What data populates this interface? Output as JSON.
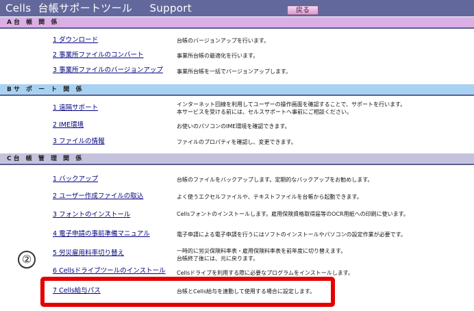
{
  "header": {
    "title": "Cells  台帳サポートツール     Support",
    "back_label": "戻る"
  },
  "sections": {
    "a": {
      "title": "A台 帳 関 係",
      "items": [
        {
          "label": "1  ダウンロード",
          "desc": "台帳のバージョンアップを行います。"
        },
        {
          "label": "2  事業所ファイルのコンバート",
          "desc": "事業所台帳の最適化を行います。"
        },
        {
          "label": "3  事業所ファイルのバージョンアップ",
          "desc": "事業所台帳を一括でバージョンアップします。"
        }
      ]
    },
    "b": {
      "title": "Bサ ポ ー ト 関 係",
      "items": [
        {
          "label": "1  遠隔サポート",
          "desc": "インターネット回線を利用してユーザーの操作画面を確認することで、サポートを行います。\n本サービスを受ける前には、セルスサポートへ事前にご相談ください。"
        },
        {
          "label": "2  IME環境",
          "desc": "お使いのパソコンのIME環境を確認できます。"
        },
        {
          "label": "3  ファイルの情報",
          "desc": "ファイルのプロパティを確認し、変更できます。"
        }
      ]
    },
    "c": {
      "title": "C台 帳 管 理 関 係",
      "items": [
        {
          "label": "1  バックアップ",
          "desc": "台帳のファイルをバックアップします。定期的なバックアップをお勧めします。"
        },
        {
          "label": "2  ユーザー作成ファイルの取込",
          "desc": "よく使うエクセルファイルや、テキストファイルを台帳から起動できます。"
        },
        {
          "label": "3  フォントのインストール",
          "desc": "Cellsフォントのインストールします。雇用保険資格取得届等のOCR用紙への印刷に使います。"
        },
        {
          "label": "4  電子申請の事前準備マニュアル",
          "desc": "電子申請による電子申請を行うにはソフトのインストールやパソコンの設定作業が必要です。"
        },
        {
          "label": "5  労災雇用料率切り替え",
          "desc": "一時的に労災保険料率表・雇用保険料率表を前年度に切り替えます。\n台帳終了後には、元に戻ります。"
        },
        {
          "label": "6  Cellsドライブツールのインストール",
          "desc": "Cellsドライブを利用する際に必要なプログラムをインストールします。"
        },
        {
          "label": "7 Cells給与パス",
          "desc": "台帳とCells給与を連動して使用する場合に設定します。"
        }
      ]
    }
  },
  "annotation": {
    "marker": "②"
  }
}
